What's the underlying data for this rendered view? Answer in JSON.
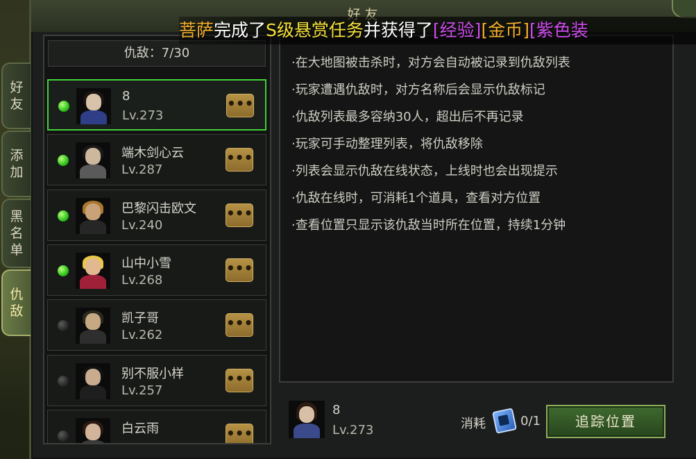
{
  "window": {
    "title": "好友"
  },
  "banner": {
    "parts": [
      {
        "text": "菩萨",
        "color": "#f5b02e"
      },
      {
        "text": "完成了",
        "color": "#ffffff"
      },
      {
        "text": "S级悬赏任务",
        "color": "#f7e23a"
      },
      {
        "text": "并获得了",
        "color": "#ffffff"
      },
      {
        "text": "[经验]",
        "color": "#d04cf0"
      },
      {
        "text": "[金币]",
        "color": "#f5b02e"
      },
      {
        "text": "[紫色装",
        "color": "#d04cf0"
      }
    ]
  },
  "side_tabs": [
    {
      "label": "好友",
      "active": false
    },
    {
      "label": "添加",
      "active": false
    },
    {
      "label": "黑名单",
      "active": false
    },
    {
      "label": "仇敌",
      "active": true
    }
  ],
  "enemy_list": {
    "count_label": "仇敌：7/30",
    "items": [
      {
        "name": "8",
        "level": "Lv.273",
        "online": true,
        "selected": true
      },
      {
        "name": "端木剑心云",
        "level": "Lv.287",
        "online": true,
        "selected": false
      },
      {
        "name": "巴黎闪击欧文",
        "level": "Lv.240",
        "online": true,
        "selected": false
      },
      {
        "name": "山中小雪",
        "level": "Lv.268",
        "online": true,
        "selected": false
      },
      {
        "name": "凯子哥",
        "level": "Lv.262",
        "online": false,
        "selected": false
      },
      {
        "name": "别不服小样",
        "level": "Lv.257",
        "online": false,
        "selected": false
      },
      {
        "name": "白云雨",
        "level": "",
        "online": false,
        "selected": false
      }
    ],
    "more_label": "•••"
  },
  "info": {
    "lines": [
      "·在大地图被击杀时，对方会自动被记录到仇敌列表",
      "·玩家遭遇仇敌时，对方名称后会显示仇敌标记",
      "·仇敌列表最多容纳30人，超出后不再记录",
      "·玩家可手动整理列表，将仇敌移除",
      "·列表会显示仇敌在线状态，上线时也会出现提示",
      "·仇敌在线时，可消耗1个道具，查看对方位置",
      "·查看位置只显示该仇敌当时所在位置，持续1分钟"
    ]
  },
  "footer": {
    "name": "8",
    "level": "Lv.273",
    "cost_label": "消耗",
    "item_icon": "locator-device-icon",
    "cost_count": "0/1",
    "track_button": "追踪位置"
  }
}
